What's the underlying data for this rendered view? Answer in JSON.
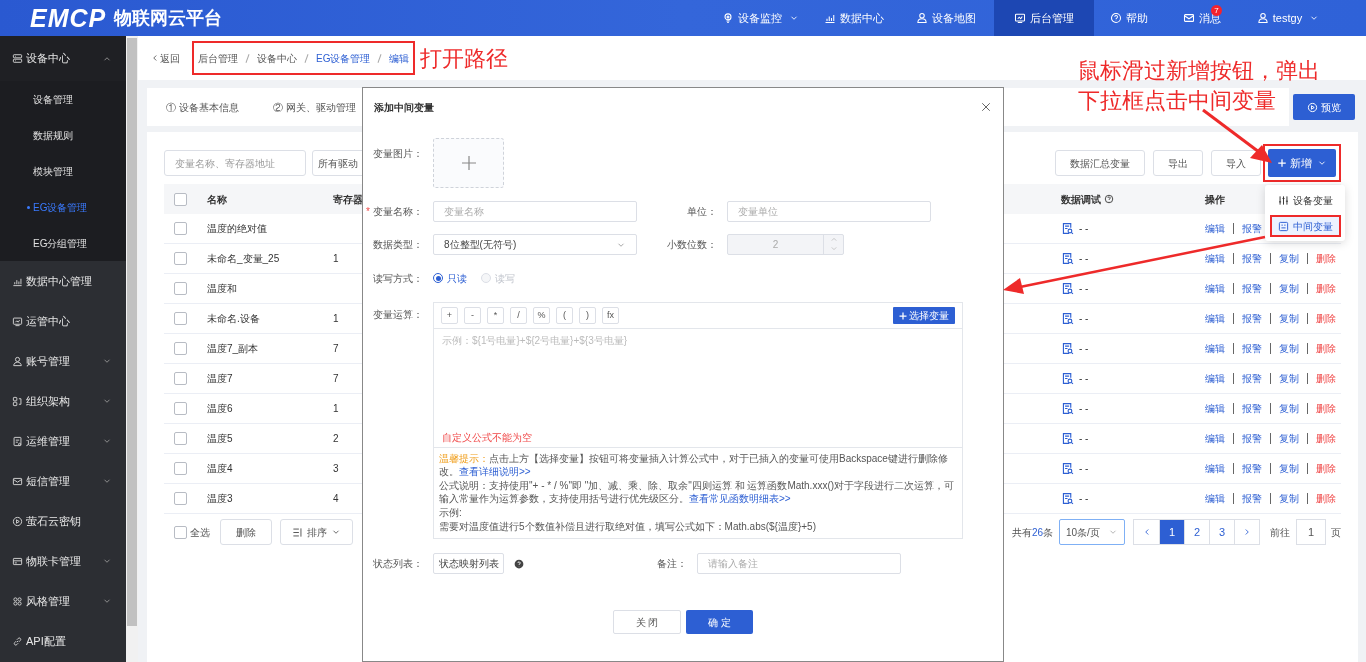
{
  "header": {
    "logo": "EMCP",
    "title": "物联网云平台",
    "nav": [
      {
        "label": "设备监控",
        "dropdown": true,
        "selected": false
      },
      {
        "label": "数据中心",
        "selected": false
      },
      {
        "label": "设备地图",
        "selected": false
      },
      {
        "label": "后台管理",
        "selected": true
      },
      {
        "label": "帮助",
        "selected": false
      },
      {
        "label": "消息",
        "badge": "7",
        "selected": false
      },
      {
        "label": "testgy",
        "dropdown": true,
        "selected": false
      }
    ]
  },
  "sidebar": {
    "items": [
      {
        "label": "设备中心",
        "expanded": true,
        "children": [
          {
            "label": "设备管理",
            "selected": false
          },
          {
            "label": "数据规则",
            "selected": false
          },
          {
            "label": "模块管理",
            "selected": false
          },
          {
            "label": "EG设备管理",
            "selected": true
          },
          {
            "label": "EG分组管理",
            "selected": false
          }
        ]
      },
      {
        "label": "数据中心管理"
      },
      {
        "label": "运管中心"
      },
      {
        "label": "账号管理",
        "expanded": false
      },
      {
        "label": "组织架构",
        "expanded": false
      },
      {
        "label": "运维管理",
        "expanded": false
      },
      {
        "label": "短信管理",
        "expanded": false
      },
      {
        "label": "萤石云密钥"
      },
      {
        "label": "物联卡管理",
        "expanded": false
      },
      {
        "label": "风格管理",
        "expanded": false
      },
      {
        "label": "API配置"
      }
    ]
  },
  "breadcrumb": {
    "back": "返回",
    "items": [
      "后台管理",
      "设备中心",
      "EG设备管理",
      "编辑"
    ]
  },
  "steps": [
    "① 设备基本信息",
    "② 网关、驱动管理"
  ],
  "preview_button": "预览",
  "toolbar": {
    "search_placeholder": "变量名称、寄存器地址",
    "driver_select": "所有驱动",
    "buttons": [
      "数据汇总变量",
      "导出",
      "导入"
    ],
    "add_button": "新增",
    "add_menu": [
      {
        "label": "设备变量",
        "selected": false
      },
      {
        "label": "中间变量",
        "selected": true
      }
    ]
  },
  "table": {
    "all_checked": false,
    "columns": [
      "名称",
      "寄存器",
      "数据调试",
      "操作"
    ],
    "rows": [
      {
        "checked": false,
        "name": "温度的绝对值",
        "debug": "- -",
        "actions": [
          {
            "label": "编辑",
            "kind": "link"
          },
          {
            "label": "报警",
            "kind": "link"
          }
        ]
      },
      {
        "checked": false,
        "name": "未命名_变量_25",
        "register": "1",
        "debug": "- -",
        "actions": [
          {
            "label": "编辑",
            "kind": "link"
          },
          {
            "label": "报警",
            "kind": "link"
          },
          {
            "label": "复制",
            "kind": "link"
          },
          {
            "label": "删除",
            "kind": "danger"
          }
        ]
      },
      {
        "checked": false,
        "name": "温度和",
        "debug": "- -",
        "actions": [
          {
            "label": "编辑",
            "kind": "link"
          },
          {
            "label": "报警",
            "kind": "link"
          },
          {
            "label": "复制",
            "kind": "link"
          },
          {
            "label": "删除",
            "kind": "danger"
          }
        ]
      },
      {
        "checked": false,
        "name": "未命名.设备",
        "register": "1",
        "debug": "- -",
        "actions": [
          {
            "label": "编辑",
            "kind": "link"
          },
          {
            "label": "报警",
            "kind": "link"
          },
          {
            "label": "复制",
            "kind": "link"
          },
          {
            "label": "删除",
            "kind": "danger"
          }
        ]
      },
      {
        "checked": false,
        "name": "温度7_副本",
        "register": "7",
        "debug": "- -",
        "actions": [
          {
            "label": "编辑",
            "kind": "link"
          },
          {
            "label": "报警",
            "kind": "link"
          },
          {
            "label": "复制",
            "kind": "link"
          },
          {
            "label": "删除",
            "kind": "danger"
          }
        ]
      },
      {
        "checked": false,
        "name": "温度7",
        "register": "7",
        "debug": "- -",
        "actions": [
          {
            "label": "编辑",
            "kind": "link"
          },
          {
            "label": "报警",
            "kind": "link"
          },
          {
            "label": "复制",
            "kind": "link"
          },
          {
            "label": "删除",
            "kind": "danger"
          }
        ]
      },
      {
        "checked": false,
        "name": "温度6",
        "register": "1",
        "debug": "- -",
        "actions": [
          {
            "label": "编辑",
            "kind": "link"
          },
          {
            "label": "报警",
            "kind": "link"
          },
          {
            "label": "复制",
            "kind": "link"
          },
          {
            "label": "删除",
            "kind": "danger"
          }
        ]
      },
      {
        "checked": false,
        "name": "温度5",
        "register": "2",
        "debug": "- -",
        "actions": [
          {
            "label": "编辑",
            "kind": "link"
          },
          {
            "label": "报警",
            "kind": "link"
          },
          {
            "label": "复制",
            "kind": "link"
          },
          {
            "label": "删除",
            "kind": "danger"
          }
        ]
      },
      {
        "checked": false,
        "name": "温度4",
        "register": "3",
        "debug": "- -",
        "actions": [
          {
            "label": "编辑",
            "kind": "link"
          },
          {
            "label": "报警",
            "kind": "link"
          },
          {
            "label": "复制",
            "kind": "link"
          },
          {
            "label": "删除",
            "kind": "danger"
          }
        ]
      },
      {
        "checked": false,
        "name": "温度3",
        "register": "4",
        "debug": "- -",
        "actions": [
          {
            "label": "编辑",
            "kind": "link"
          },
          {
            "label": "报警",
            "kind": "link"
          },
          {
            "label": "复制",
            "kind": "link"
          },
          {
            "label": "删除",
            "kind": "danger"
          }
        ]
      }
    ]
  },
  "footer": {
    "select_all": {
      "label": "全选",
      "checked": false
    },
    "delete_button": "删除",
    "sort_button": "排序",
    "total_prefix": "共有",
    "total_count": "26",
    "total_suffix": "条",
    "page_size": "10条/页",
    "pages": [
      {
        "label": "1",
        "selected": true
      },
      {
        "label": "2",
        "selected": false
      },
      {
        "label": "3",
        "selected": false
      }
    ],
    "goto_label": "前往",
    "goto_value": "1",
    "goto_suffix": "页"
  },
  "dialog": {
    "title": "添加中间变量",
    "image_label": "变量图片：",
    "name": {
      "label": "变量名称：",
      "required": true,
      "placeholder": "变量名称"
    },
    "unit": {
      "label": "单位：",
      "placeholder": "变量单位"
    },
    "data_type": {
      "label": "数据类型：",
      "value": "8位整型(无符号)"
    },
    "decimals": {
      "label": "小数位数：",
      "value": "2",
      "disabled": true
    },
    "access": {
      "label": "读写方式：",
      "options": [
        {
          "label": "只读",
          "selected": true,
          "disabled": false
        },
        {
          "label": "读写",
          "selected": false,
          "disabled": true
        }
      ]
    },
    "formula": {
      "label": "变量运算：",
      "operators": [
        "+",
        "-",
        "*",
        "/",
        "%",
        "(",
        ")",
        "fx"
      ],
      "select_button": "选择变量",
      "placeholder": "示例：${1号电量}+${2号电量}+${3号电量}",
      "error": "自定义公式不能为空",
      "tip_label": "温馨提示：",
      "tip": "点击上方【选择变量】按钮可将变量插入计算公式中，对于已插入的变量可使用Backspace键进行删除修改。",
      "tip_link": "查看详细说明>>",
      "note": "公式说明：支持使用\"+ - * / %\"即 \"加、减、乘、除、取余\"四则运算 和 运算函数Math.xxx()对于字段进行二次运算，可输入常量作为运算参数，支持使用括号进行优先级区分。",
      "note_link": "查看常见函数明细表>>",
      "example_label": "示例:",
      "example": "需要对温度值进行5个数值补偿且进行取绝对值，填写公式如下：Math.abs(${温度}+5)"
    },
    "status": {
      "label": "状态列表：",
      "button": "状态映射列表"
    },
    "remark": {
      "label": "备注：",
      "placeholder": "请输入备注"
    },
    "cancel_button": "关 闭",
    "ok_button": "确 定"
  },
  "annotations": {
    "path_note": "打开路径",
    "hover_note": [
      "鼠标滑过新增按钮，弹出",
      "下拉框点击中间变量"
    ]
  }
}
